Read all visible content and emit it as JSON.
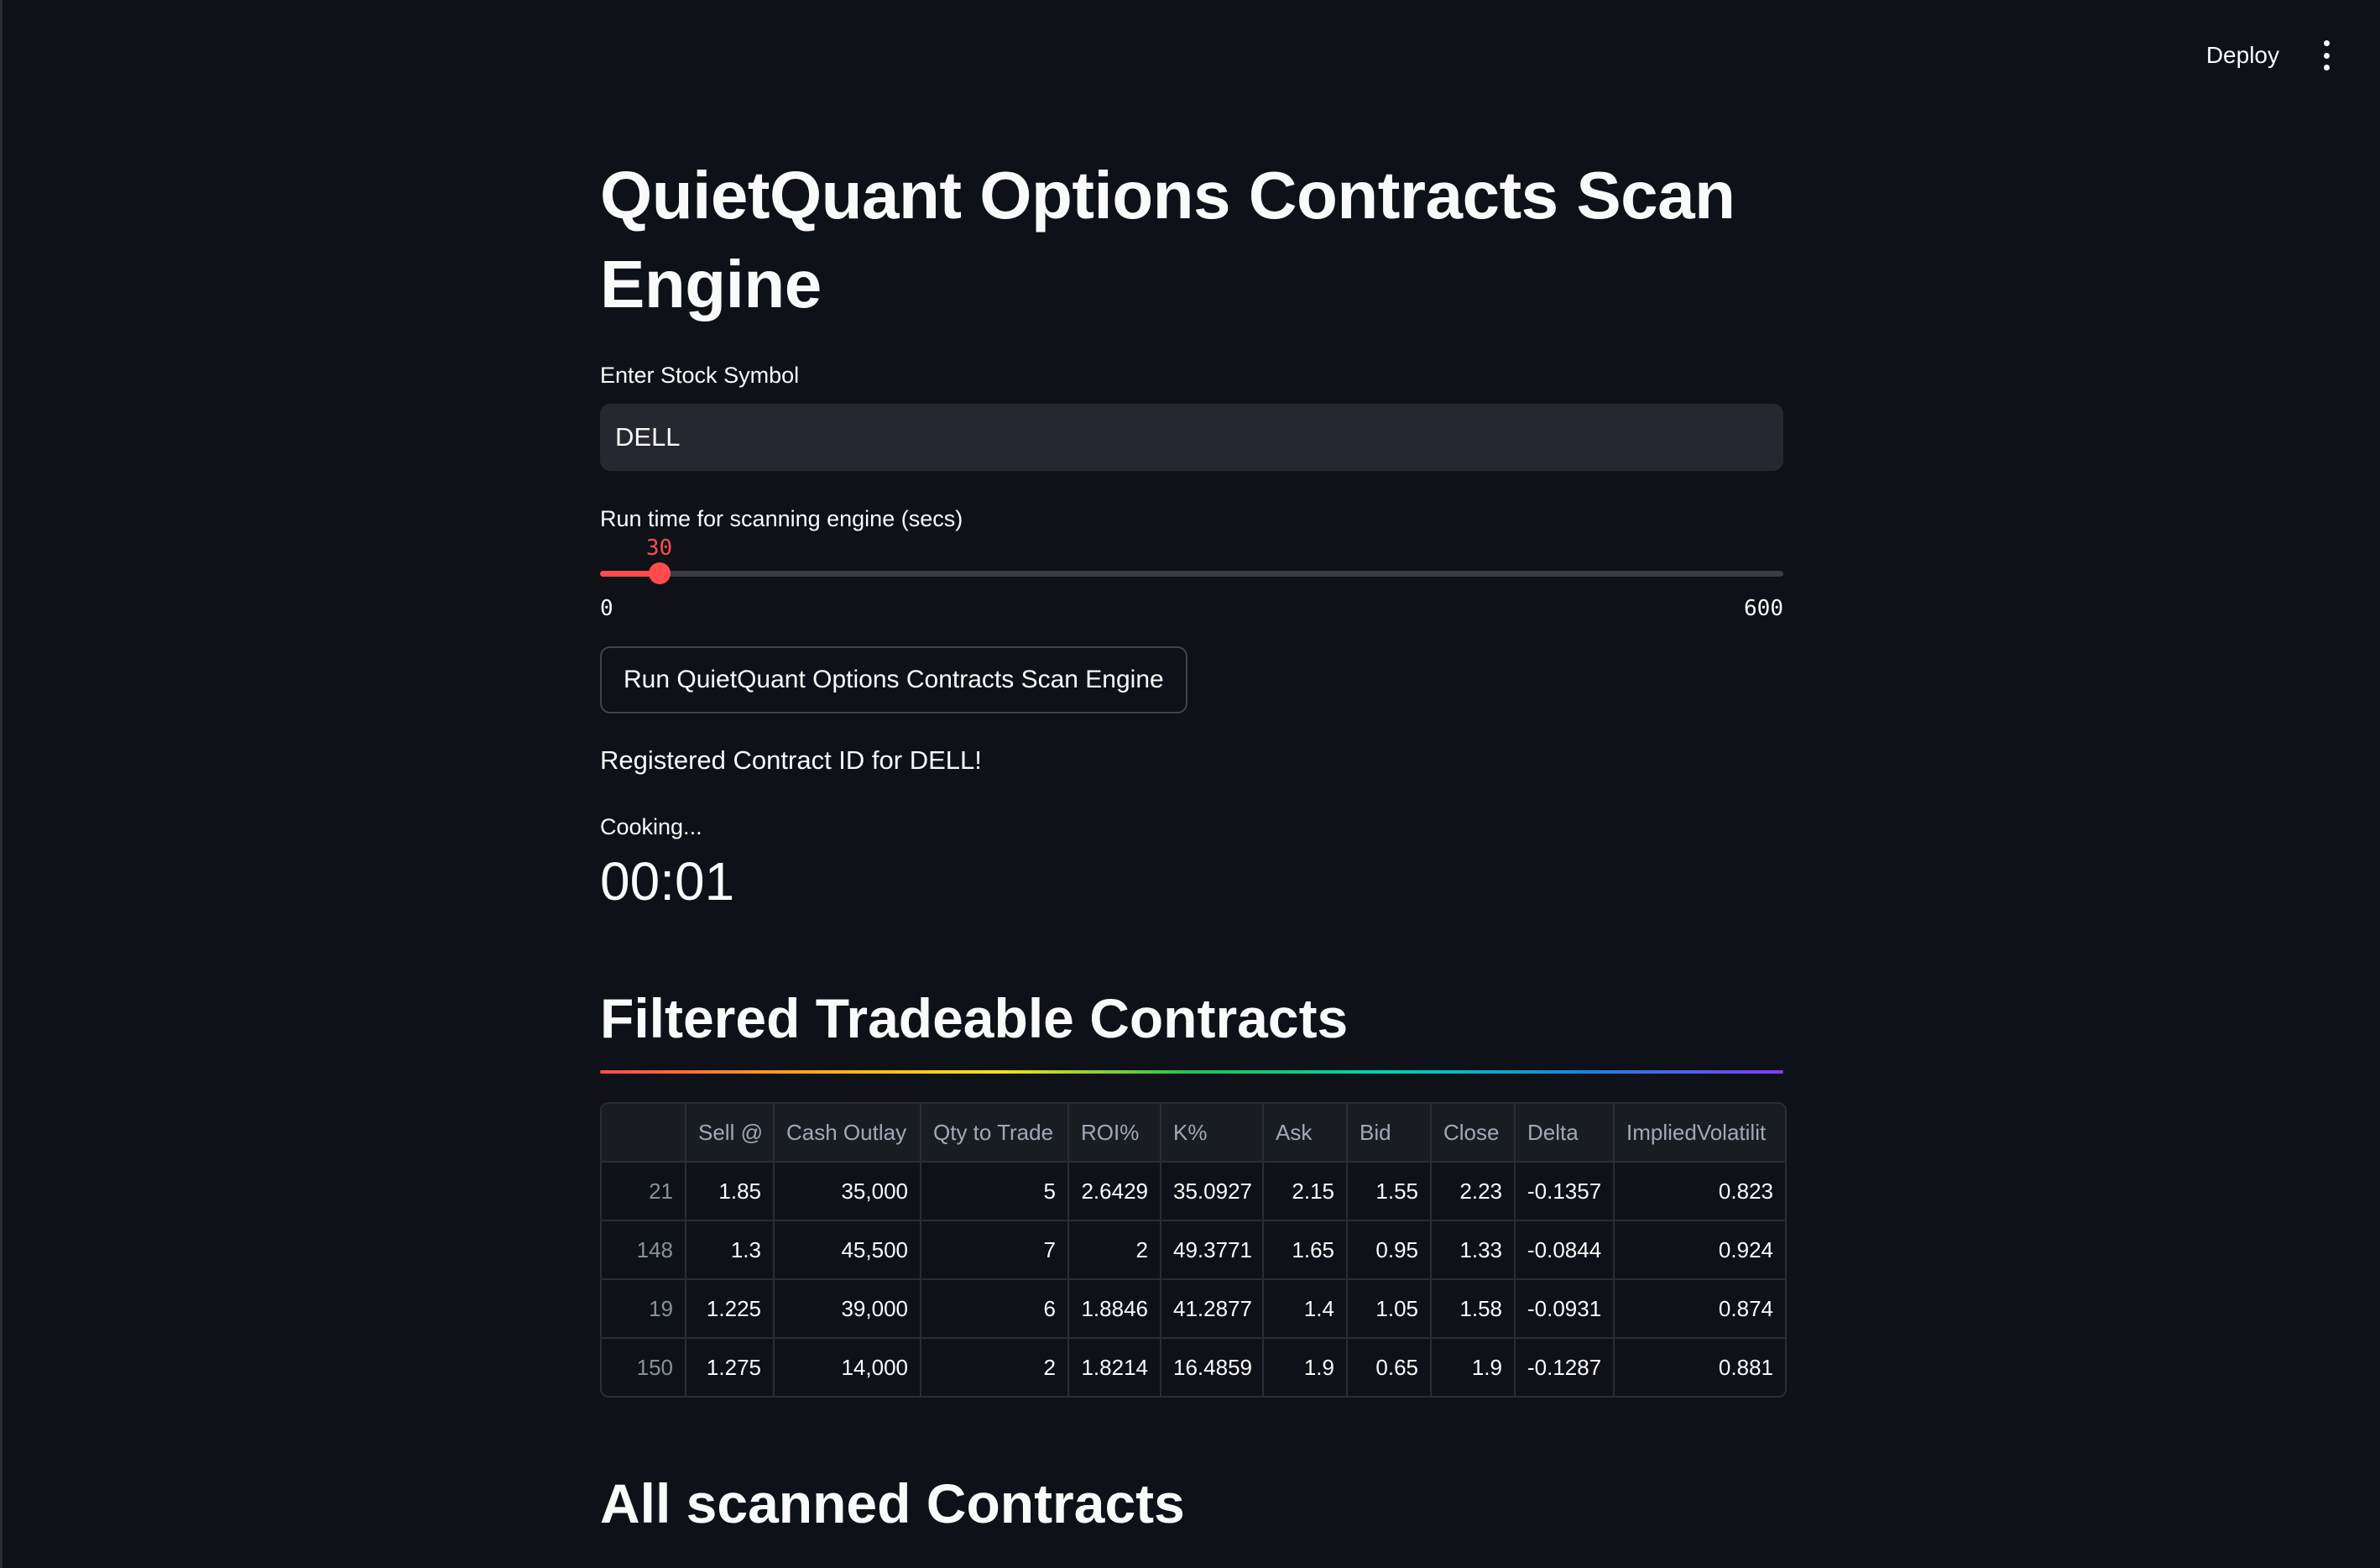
{
  "header": {
    "deploy_label": "Deploy",
    "menu_icon": "vertical-ellipsis-icon"
  },
  "main": {
    "title": "QuietQuant Options Contracts Scan Engine",
    "symbol_input": {
      "label": "Enter Stock Symbol",
      "value": "DELL"
    },
    "runtime_slider": {
      "label": "Run time for scanning engine (secs)",
      "value": 30,
      "value_label": "30",
      "min": 0,
      "max": 600,
      "min_label": "0",
      "max_label": "600"
    },
    "run_button_label": "Run QuietQuant Options Contracts Scan Engine",
    "status_message": "Registered Contract ID for DELL!",
    "timer": {
      "label": "Cooking...",
      "value": "00:01"
    },
    "filtered_section_title": "Filtered Tradeable Contracts",
    "filtered_table": {
      "columns": [
        "",
        "Sell @",
        "Cash Outlay",
        "Qty to Trade",
        "ROI%",
        "K%",
        "Ask",
        "Bid",
        "Close",
        "Delta",
        "ImpliedVolatilit"
      ],
      "rows": [
        [
          "21",
          "1.85",
          "35,000",
          "5",
          "2.6429",
          "35.0927",
          "2.15",
          "1.55",
          "2.23",
          "-0.1357",
          "0.823"
        ],
        [
          "148",
          "1.3",
          "45,500",
          "7",
          "2",
          "49.3771",
          "1.65",
          "0.95",
          "1.33",
          "-0.0844",
          "0.924"
        ],
        [
          "19",
          "1.225",
          "39,000",
          "6",
          "1.8846",
          "41.2877",
          "1.4",
          "1.05",
          "1.58",
          "-0.0931",
          "0.874"
        ],
        [
          "150",
          "1.275",
          "14,000",
          "2",
          "1.8214",
          "16.4859",
          "1.9",
          "0.65",
          "1.9",
          "-0.1287",
          "0.881"
        ]
      ]
    },
    "all_section_title": "All scanned Contracts"
  }
}
